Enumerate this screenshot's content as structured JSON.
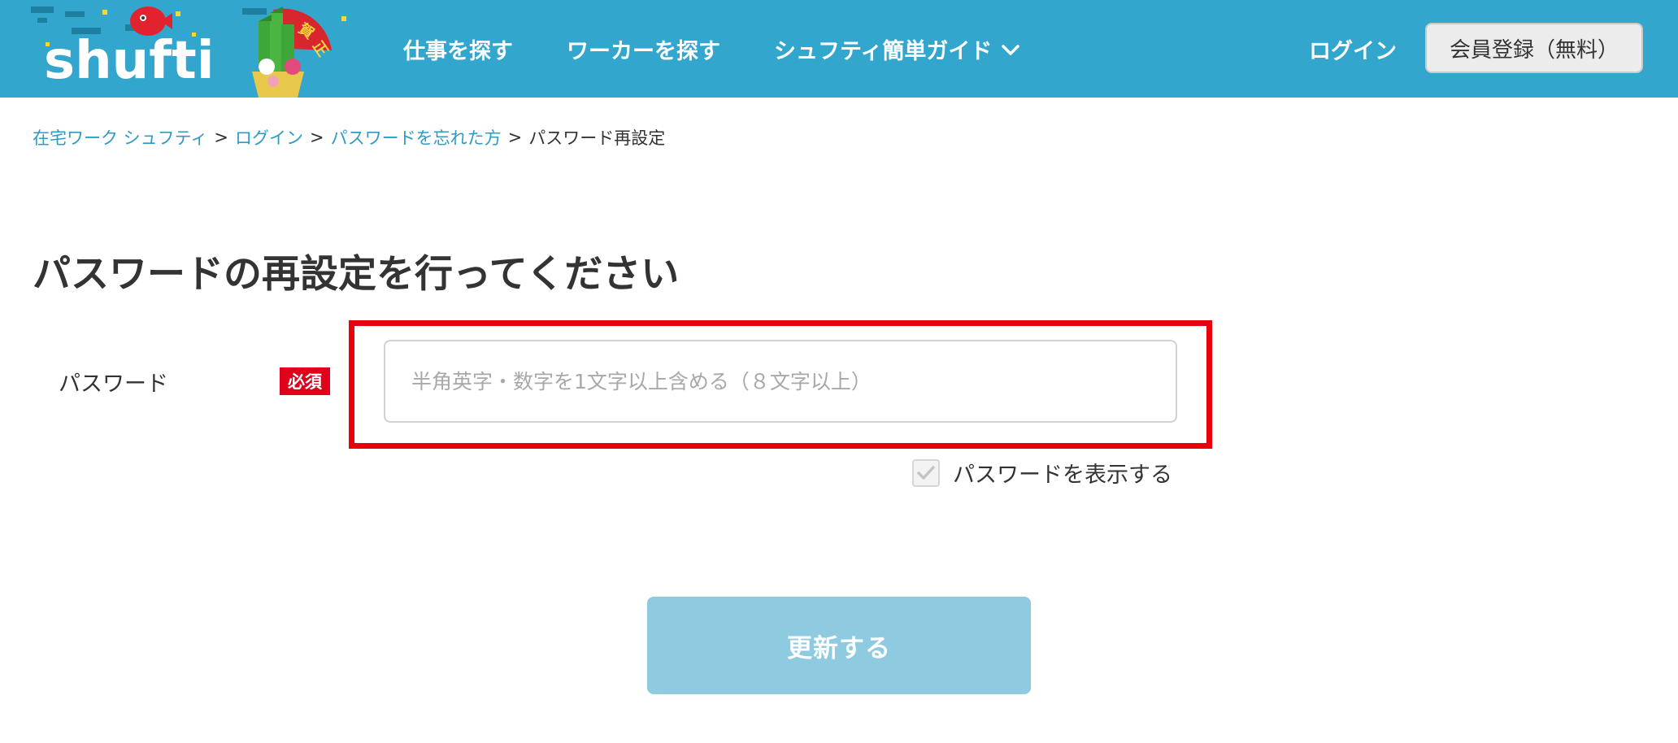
{
  "colors": {
    "header_bg": "#32a6cc",
    "link": "#2e9bc5",
    "required": "#e0001b",
    "highlight": "#e8000b",
    "submit_bg": "#8ecbe0"
  },
  "header": {
    "logo_text": "shufti",
    "nav": [
      {
        "label": "仕事を探す"
      },
      {
        "label": "ワーカーを探す"
      },
      {
        "label": "シュフティ簡単ガイド",
        "icon": "chevron-down-icon"
      }
    ],
    "login_label": "ログイン",
    "register_label": "会員登録（無料）"
  },
  "breadcrumb": {
    "items": [
      {
        "label": "在宅ワーク シュフティ"
      },
      {
        "label": "ログイン"
      },
      {
        "label": "パスワードを忘れた方"
      }
    ],
    "separator": ">",
    "current": "パスワード再設定"
  },
  "main": {
    "title": "パスワードの再設定を行ってください",
    "password_label": "パスワード",
    "required_label": "必須",
    "password_placeholder": "半角英字・数字を1文字以上含める（８文字以上）",
    "password_value": "",
    "show_password_label": "パスワードを表示する",
    "submit_label": "更新する"
  }
}
